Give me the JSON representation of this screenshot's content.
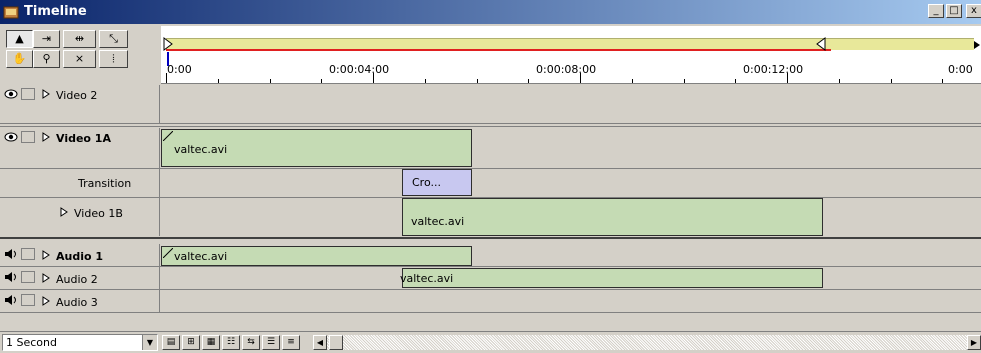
{
  "window": {
    "title": "Timeline",
    "controls": {
      "minimize": "_",
      "maximize": "□",
      "close": "x"
    }
  },
  "tools": [
    {
      "name": "selection-tool-icon",
      "glyph": "▲"
    },
    {
      "name": "track-tool-icon",
      "glyph": "⇥"
    },
    {
      "name": "multitrack-tool-icon",
      "glyph": "⇹"
    },
    {
      "name": "link-tool-icon",
      "glyph": "⤡"
    },
    {
      "name": "hand-tool-icon",
      "glyph": "✋"
    },
    {
      "name": "zoom-tool-icon",
      "glyph": "⚲"
    },
    {
      "name": "ripple-edit-tool-icon",
      "glyph": "⨯"
    },
    {
      "name": "in-point-tool-icon",
      "glyph": "⦙"
    }
  ],
  "ruler": {
    "labels": [
      "0:00",
      "0:00:04:00",
      "0:00:08:00",
      "0:00:12:00",
      "0:00"
    ]
  },
  "tracks": [
    {
      "id": "video2",
      "name": "Video 2",
      "type": "video",
      "bold": false
    },
    {
      "id": "video1a",
      "name": "Video 1A",
      "type": "video",
      "bold": true
    },
    {
      "id": "transition",
      "name": "Transition",
      "type": "transition",
      "bold": false
    },
    {
      "id": "video1b",
      "name": "Video 1B",
      "type": "video",
      "bold": false
    },
    {
      "id": "audio1",
      "name": "Audio 1",
      "type": "audio",
      "bold": true
    },
    {
      "id": "audio2",
      "name": "Audio 2",
      "type": "audio",
      "bold": false
    },
    {
      "id": "audio3",
      "name": "Audio 3",
      "type": "audio",
      "bold": false
    }
  ],
  "clips": {
    "video1a": "valtec.avi",
    "transition": "Cro...",
    "video1b": "valtec.avi",
    "audio1": "valtec.avi",
    "audio2": "valtec.avi"
  },
  "status": {
    "zoom": "1 Second"
  },
  "colors": {
    "clip_fill": "#c5dbb4",
    "transition_fill": "#c8c8f0",
    "work_area": "#e8e89a",
    "work_area_red": "#e02020",
    "title_bar_start": "#0a246a"
  }
}
